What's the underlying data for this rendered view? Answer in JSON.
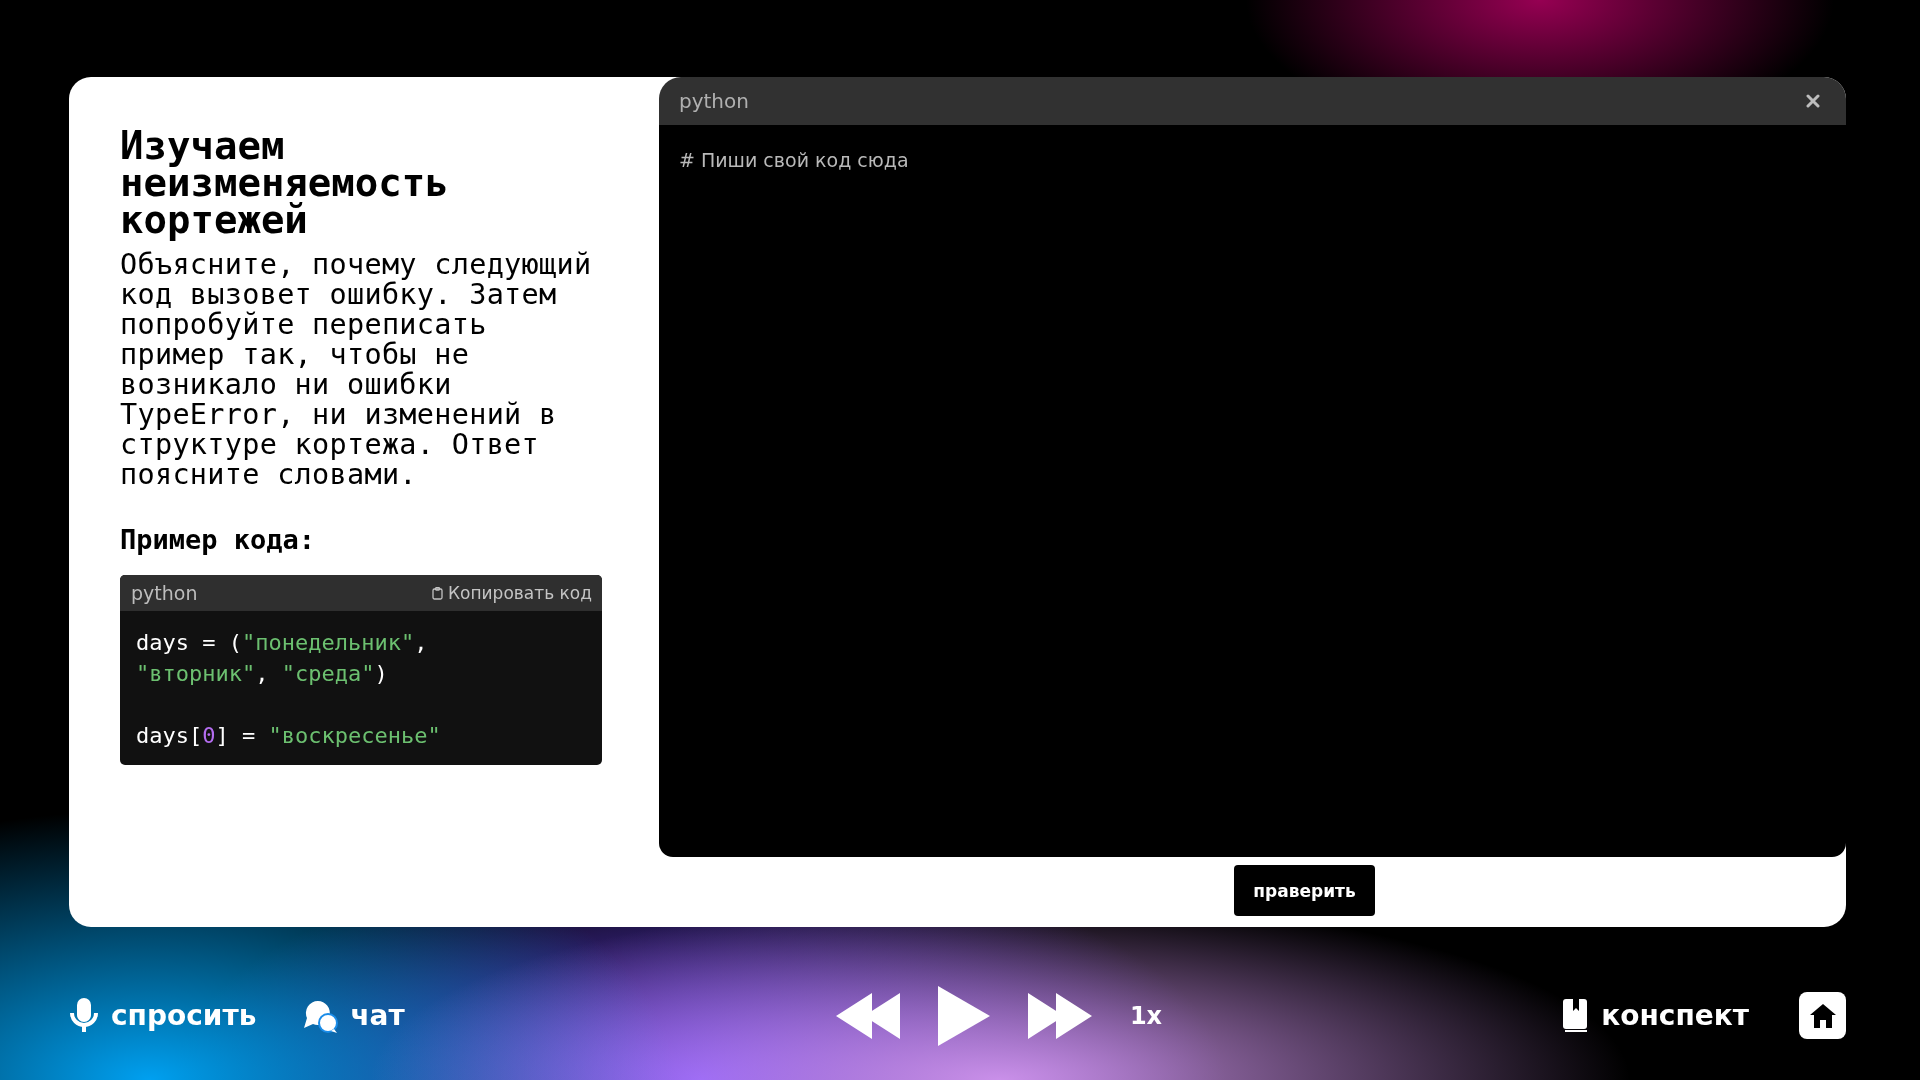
{
  "task": {
    "title": "Изучаем неизменяемость кортежей",
    "description": "Объясните, почему следующий код вызовет ошибку. Затем попробуйте переписать пример так, чтобы не возникало ни ошибки TypeError, ни изменений в структуре кортежа. Ответ поясните словами.",
    "example_heading": "Пример кода:"
  },
  "code_sample": {
    "language": "python",
    "copy_label": "Копировать код",
    "statements": [
      {
        "lines": [
          [
            {
              "kind": "plain",
              "text": "days = ("
            },
            {
              "kind": "string",
              "text": "\"понедельник\""
            },
            {
              "kind": "plain",
              "text": ","
            }
          ],
          [
            {
              "kind": "string",
              "text": "\"вторник\""
            },
            {
              "kind": "plain",
              "text": ", "
            },
            {
              "kind": "string",
              "text": "\"среда\""
            },
            {
              "kind": "plain",
              "text": ")"
            }
          ]
        ]
      },
      {
        "lines": [
          [
            {
              "kind": "plain",
              "text": "days["
            },
            {
              "kind": "number",
              "text": "0"
            },
            {
              "kind": "plain",
              "text": "] = "
            },
            {
              "kind": "string",
              "text": "\"воскресенье\""
            }
          ]
        ]
      }
    ]
  },
  "editor": {
    "language": "python",
    "placeholder": "# Пиши свой код сюда",
    "submit_label": "праверить"
  },
  "player": {
    "ask_label": "спросить",
    "chat_label": "чат",
    "speed": "1x",
    "notes_label": "конспект"
  }
}
